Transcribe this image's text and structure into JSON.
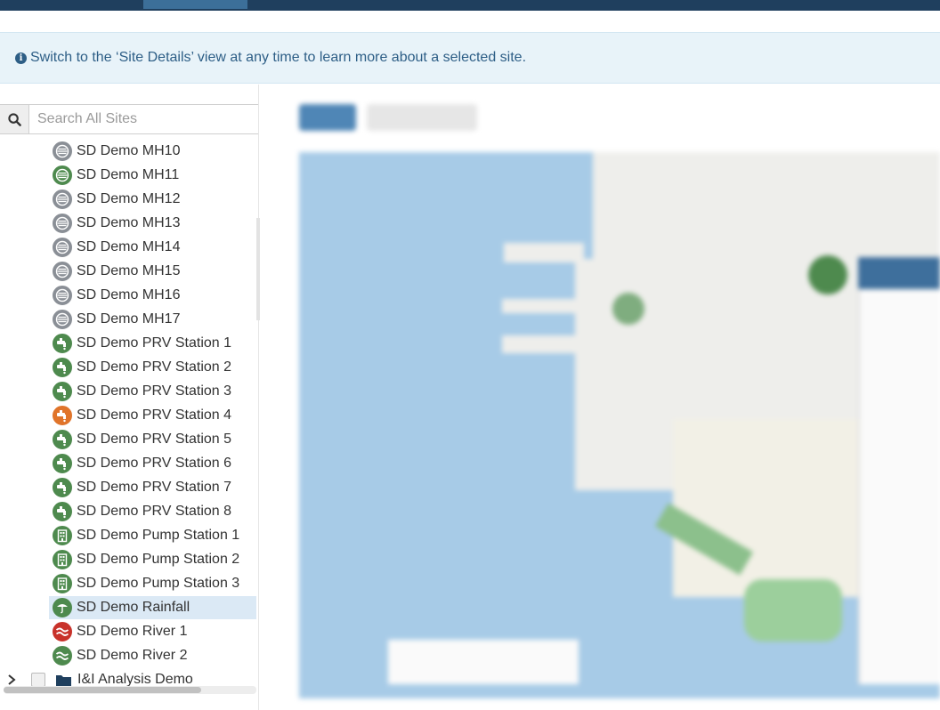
{
  "banner": {
    "info_icon": "info-circle-icon",
    "text": "Switch to the ‘Site Details’ view at any time to learn more about a selected site."
  },
  "search": {
    "placeholder": "Search All Sites",
    "value": "",
    "icon": "search-icon"
  },
  "colors": {
    "gray": "#8a8f96",
    "green": "#4e8a4e",
    "orange": "#e0742a",
    "red": "#c8322a",
    "selected_bg": "#dbe9f5",
    "banner_text": "#2d5e86"
  },
  "sites": [
    {
      "label": "SD Demo MH10",
      "icon": "manhole-icon",
      "status": "gray"
    },
    {
      "label": "SD Demo MH11",
      "icon": "manhole-icon",
      "status": "green"
    },
    {
      "label": "SD Demo MH12",
      "icon": "manhole-icon",
      "status": "gray"
    },
    {
      "label": "SD Demo MH13",
      "icon": "manhole-icon",
      "status": "gray"
    },
    {
      "label": "SD Demo MH14",
      "icon": "manhole-icon",
      "status": "gray"
    },
    {
      "label": "SD Demo MH15",
      "icon": "manhole-icon",
      "status": "gray"
    },
    {
      "label": "SD Demo MH16",
      "icon": "manhole-icon",
      "status": "gray"
    },
    {
      "label": "SD Demo MH17",
      "icon": "manhole-icon",
      "status": "gray"
    },
    {
      "label": "SD Demo PRV Station 1",
      "icon": "faucet-icon",
      "status": "green"
    },
    {
      "label": "SD Demo PRV Station 2",
      "icon": "faucet-icon",
      "status": "green"
    },
    {
      "label": "SD Demo PRV Station 3",
      "icon": "faucet-icon",
      "status": "green"
    },
    {
      "label": "SD Demo PRV Station 4",
      "icon": "faucet-icon",
      "status": "orange"
    },
    {
      "label": "SD Demo PRV Station 5",
      "icon": "faucet-icon",
      "status": "green"
    },
    {
      "label": "SD Demo PRV Station 6",
      "icon": "faucet-icon",
      "status": "green"
    },
    {
      "label": "SD Demo PRV Station 7",
      "icon": "faucet-icon",
      "status": "green"
    },
    {
      "label": "SD Demo PRV Station 8",
      "icon": "faucet-icon",
      "status": "green"
    },
    {
      "label": "SD Demo Pump Station 1",
      "icon": "building-icon",
      "status": "green"
    },
    {
      "label": "SD Demo Pump Station 2",
      "icon": "building-icon",
      "status": "green"
    },
    {
      "label": "SD Demo Pump Station 3",
      "icon": "building-icon",
      "status": "green"
    },
    {
      "label": "SD Demo Rainfall",
      "icon": "rain-gauge-icon",
      "status": "green",
      "selected": true
    },
    {
      "label": "SD Demo River 1",
      "icon": "river-icon",
      "status": "red"
    },
    {
      "label": "SD Demo River 2",
      "icon": "river-icon",
      "status": "green"
    }
  ],
  "group": {
    "label": "I&I Analysis Demo",
    "expand_icon": "chevron-right-icon",
    "checkbox_checked": false,
    "folder_icon": "folder-icon"
  }
}
